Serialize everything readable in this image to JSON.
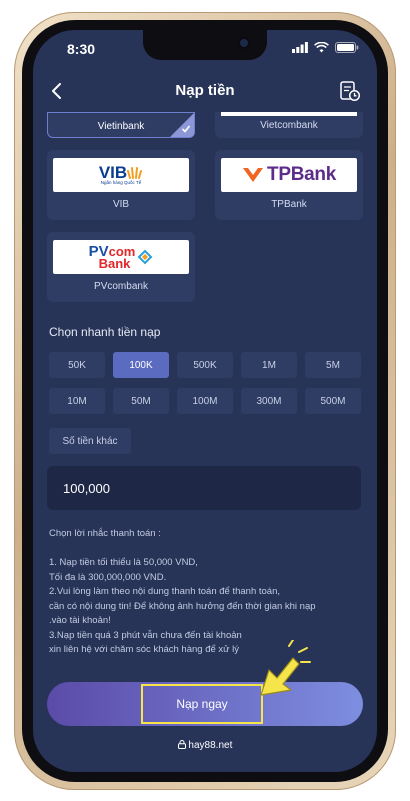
{
  "status_bar": {
    "time": "8:30"
  },
  "header": {
    "title": "Nạp tiền"
  },
  "banks": {
    "vietinbank": {
      "label": "Vietinbank",
      "selected": true
    },
    "vietcombank": {
      "label": "Vietcombank"
    },
    "vib": {
      "label": "VIB",
      "logo_text": "VIB",
      "logo_subtext": "Ngân hàng Quốc Tế"
    },
    "tpbank": {
      "label": "TPBank",
      "logo_text": "TPBank"
    },
    "pvcombank": {
      "label": "PVcombank",
      "logo_text_1": "PV",
      "logo_text_2": "com",
      "logo_text_3": "Bank"
    }
  },
  "quick_amount": {
    "title": "Chọn nhanh tiền nạp",
    "options": [
      "50K",
      "100K",
      "500K",
      "1M",
      "5M",
      "10M",
      "50M",
      "100M",
      "300M",
      "500M"
    ],
    "active_index": 1,
    "other_label": "Số tiền khác"
  },
  "amount_input": {
    "value": "100,000"
  },
  "notes": {
    "title": "Chọn lời nhắc thanh toán :",
    "lines": [
      "1. Nạp tiền tối thiểu là 50,000 VND,",
      "Tối đa là 300,000,000 VND.",
      "2.Vui lòng làm theo nội dung thanh toán để thanh toán,",
      "cần có nội dung tin! Để không ảnh hưởng đến thời gian khi nạp",
      ".vào tài khoản!",
      "3.Nạp tiền quá 3 phút vẫn chưa đến tài khoản",
      "xin liên hệ với chăm sóc khách hàng để xử lý"
    ]
  },
  "submit": {
    "label": "Nạp ngay"
  },
  "footer": {
    "domain": "hay88.net"
  },
  "colors": {
    "screen_bg": "#273457",
    "card_bg": "#2f3d65",
    "active": "#5a6bc0",
    "highlight": "#f6e54a"
  }
}
